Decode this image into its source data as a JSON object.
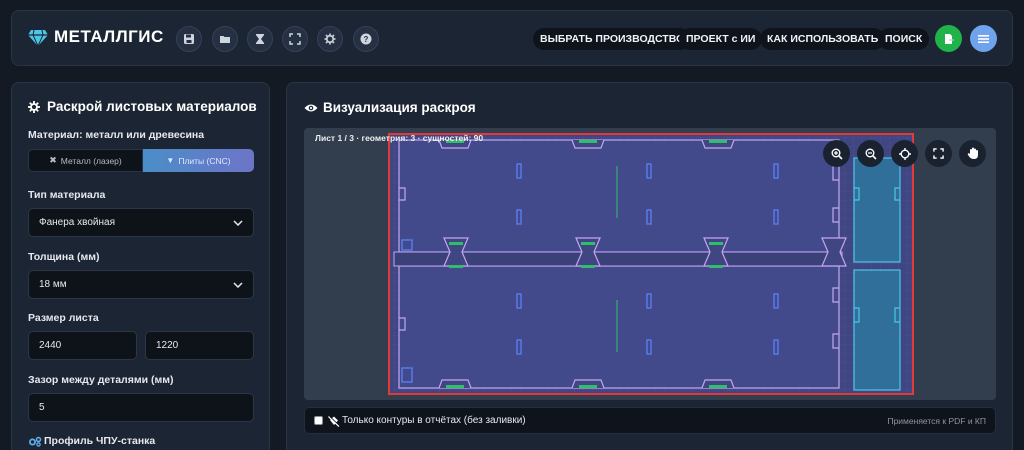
{
  "header": {
    "app_title": "МЕТАЛЛГИС",
    "tools": [
      "save-icon",
      "folder-icon",
      "hourglass-icon",
      "fullscreen-icon",
      "gear-icon",
      "help-icon"
    ],
    "nav": {
      "choose_production": "ВЫБРАТЬ ПРОИЗВОДСТВО",
      "ai_project": "ПРОЕКТ с ИИ",
      "how_to_use": "КАК ИСПОЛЬЗОВАТЬ",
      "search": "ПОИСК"
    },
    "colors": {
      "export_green": "#1fb34a",
      "menu_blue": "#6fa3ee",
      "brand_cyan": "#4cc6e8"
    }
  },
  "left_panel": {
    "title": "Раскрой листовых материалов",
    "material_label": "Материал: металл или древесина",
    "material_options": {
      "metal": "Металл (лазер)",
      "plates": "Плиты (CNC)"
    },
    "material_selected": "Плиты (CNC)",
    "material_type_label": "Тип материала",
    "material_type_value": "Фанера хвойная",
    "thickness_label": "Толщина (мм)",
    "thickness_value": "18 мм",
    "sheet_size_label": "Размер листа",
    "sheet_width": "2440",
    "sheet_height": "1220",
    "gap_label": "Зазор между деталями (мм)",
    "gap_value": "5",
    "cnc_profile_label": "Профиль ЧПУ-станка"
  },
  "right_panel": {
    "title": "Визуализация раскроя",
    "sheet_info": "Лист 1 / 3 · геометрия: 3 · сущностей: 90",
    "zoom_tools": [
      "zoom-in-icon",
      "zoom-out-icon",
      "crosshair-icon",
      "fit-screen-icon",
      "hand-icon"
    ],
    "outline_only_label": "Только контуры в отчётах (без заливки)",
    "outline_only_checked": false,
    "applies_note": "Применяется к PDF и КП"
  }
}
